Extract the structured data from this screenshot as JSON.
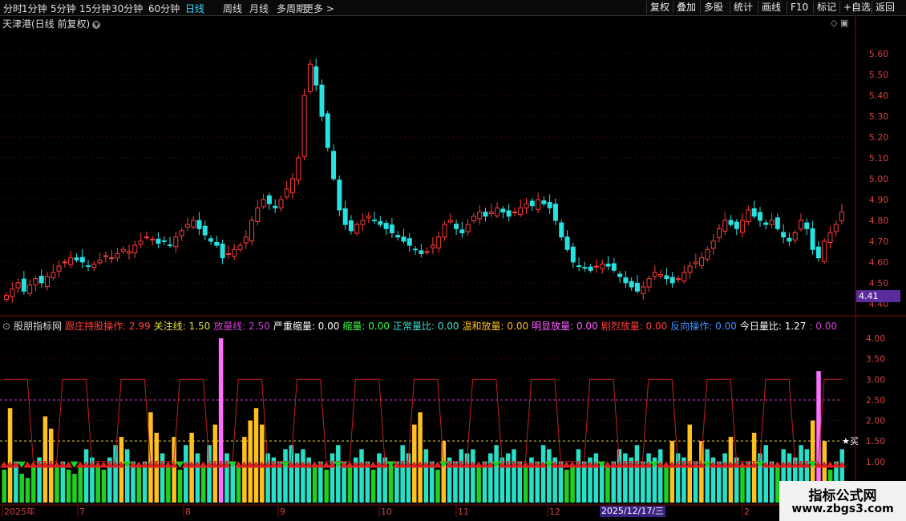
{
  "toolbar": {
    "periods": [
      "分时",
      "1分钟",
      "5分钟",
      "15分钟",
      "30分钟",
      "60分钟",
      "日线",
      "周线",
      "月线",
      "多周期",
      "更多 >"
    ],
    "active_period": "日线",
    "right_buttons": [
      "复权",
      "叠加",
      "多股",
      "统计",
      "画线",
      "F10",
      "标记",
      "+自选",
      "返回"
    ]
  },
  "main_chart": {
    "title": "天津港(日线 前复权)",
    "price_axis": [
      "5.60",
      "5.50",
      "5.40",
      "5.30",
      "5.20",
      "5.10",
      "5.00",
      "4.90",
      "4.80",
      "4.70",
      "4.60",
      "4.50",
      "4.40"
    ],
    "current_price": "4.41"
  },
  "indicator": {
    "name": "股朋指标网",
    "items": [
      {
        "text": "跟庄持股操作: 2.99",
        "color": "#ff4040"
      },
      {
        "text": "关注线: 1.50",
        "color": "#e8e040"
      },
      {
        "text": "放量线: 2.50",
        "color": "#d040d0"
      },
      {
        "text": "严重缩量: 0.00",
        "color": "#ffffff"
      },
      {
        "text": "缩量: 0.00",
        "color": "#40ff40"
      },
      {
        "text": "正常量比: 0.00",
        "color": "#40e0d0"
      },
      {
        "text": "温和放量: 0.00",
        "color": "#ffc020"
      },
      {
        "text": "明显放量: 0.00",
        "color": "#ff60ff"
      },
      {
        "text": "剧烈放量: 0.00",
        "color": "#ff4040"
      },
      {
        "text": "反向操作: 0.00",
        "color": "#4090ff"
      },
      {
        "text": "今日量比: 1.27",
        "color": "#ffffff"
      },
      {
        "text": ": 0.00",
        "color": "#d040d0"
      }
    ],
    "axis": [
      "4.00",
      "3.50",
      "3.00",
      "2.50",
      "2.00",
      "1.50",
      "1.00"
    ],
    "buy_label": "★买"
  },
  "date_axis": {
    "labels": [
      "2025年",
      "7",
      "8",
      "9",
      "10",
      "11",
      "12",
      "2"
    ],
    "selected_date": "2025/12/17/三"
  },
  "watermark": {
    "line1": "指标公式网",
    "line2": "www.zbgs3.com"
  },
  "colors": {
    "up": "#ff3b3b",
    "down": "#28e0e0",
    "bg": "#000000"
  },
  "chart_data": [
    {
      "type": "candlestick",
      "title": "天津港(日线 前复权)",
      "ylim": [
        4.38,
        5.72
      ],
      "close": [
        4.44,
        4.47,
        4.5,
        4.46,
        4.49,
        4.52,
        4.5,
        4.53,
        4.55,
        4.58,
        4.6,
        4.62,
        4.61,
        4.6,
        4.58,
        4.59,
        4.61,
        4.63,
        4.62,
        4.64,
        4.66,
        4.65,
        4.68,
        4.7,
        4.72,
        4.71,
        4.69,
        4.7,
        4.68,
        4.72,
        4.75,
        4.78,
        4.8,
        4.76,
        4.73,
        4.7,
        4.68,
        4.62,
        4.64,
        4.66,
        4.68,
        4.72,
        4.8,
        4.86,
        4.9,
        4.88,
        4.86,
        4.9,
        4.95,
        5.0,
        5.1,
        5.4,
        5.55,
        5.45,
        5.3,
        5.15,
        5.0,
        4.85,
        4.78,
        4.75,
        4.78,
        4.8,
        4.82,
        4.8,
        4.78,
        4.76,
        4.74,
        4.72,
        4.7,
        4.68,
        4.66,
        4.64,
        4.65,
        4.68,
        4.72,
        4.78,
        4.8,
        4.76,
        4.74,
        4.78,
        4.82,
        4.84,
        4.82,
        4.84,
        4.86,
        4.84,
        4.82,
        4.84,
        4.86,
        4.88,
        4.87,
        4.9,
        4.88,
        4.86,
        4.8,
        4.72,
        4.66,
        4.6,
        4.58,
        4.57,
        4.56,
        4.58,
        4.59,
        4.58,
        4.56,
        4.53,
        4.5,
        4.48,
        4.46,
        4.48,
        4.52,
        4.55,
        4.54,
        4.52,
        4.5,
        4.52,
        4.55,
        4.58,
        4.6,
        4.62,
        4.66,
        4.7,
        4.76,
        4.8,
        4.78,
        4.76,
        4.8,
        4.85,
        4.82,
        4.8,
        4.78,
        4.8,
        4.76,
        4.72,
        4.7,
        4.74,
        4.8,
        4.76,
        4.66,
        4.62,
        4.7,
        4.74,
        4.78,
        4.84
      ]
    },
    {
      "type": "bar",
      "title": "股朋指标网",
      "ylim": [
        0,
        4.1
      ],
      "series": [
        {
          "name": "关注线",
          "constant": 1.5
        },
        {
          "name": "放量线",
          "constant": 2.5
        }
      ],
      "volume_ratio": [
        0.8,
        2.3,
        1.0,
        0.7,
        0.6,
        0.9,
        1.1,
        2.1,
        1.8,
        0.9,
        1.0,
        0.8,
        0.7,
        0.9,
        1.3,
        1.1,
        0.9,
        0.8,
        1.1,
        1.4,
        1.6,
        1.3,
        1.0,
        0.9,
        1.0,
        2.2,
        1.7,
        1.2,
        0.9,
        1.6,
        0.8,
        1.4,
        1.7,
        1.2,
        0.9,
        1.4,
        1.9,
        4.0,
        1.2,
        1.0,
        0.9,
        1.6,
        2.0,
        2.3,
        1.9,
        1.2,
        1.1,
        1.0,
        1.3,
        1.4,
        1.2,
        1.3,
        1.1,
        0.9,
        1.0,
        0.8,
        1.2,
        1.4,
        1.0,
        0.9,
        1.1,
        1.3,
        1.0,
        0.8,
        1.2,
        1.1,
        0.9,
        1.0,
        1.4,
        1.2,
        1.9,
        2.2,
        1.3,
        1.0,
        0.8,
        1.5,
        1.1,
        1.0,
        1.3,
        1.2,
        1.3,
        0.9,
        1.0,
        1.2,
        1.4,
        1.1,
        1.2,
        1.3,
        1.0,
        0.9,
        1.1,
        1.0,
        1.4,
        1.3,
        1.1,
        1.0,
        0.8,
        0.9,
        1.3,
        1.0,
        1.1,
        1.2,
        1.0,
        0.9,
        1.0,
        1.3,
        1.2,
        1.1,
        1.4,
        1.0,
        1.2,
        1.1,
        1.3,
        0.9,
        1.5,
        1.2,
        1.1,
        1.9,
        1.0,
        1.5,
        1.3,
        1.1,
        1.0,
        1.2,
        1.6,
        1.1,
        0.9,
        1.0,
        1.7,
        1.2,
        1.4,
        1.0,
        0.9,
        1.3,
        1.2,
        1.1,
        1.4,
        1.3,
        2.0,
        3.2,
        1.5,
        0.8,
        1.0,
        1.3
      ]
    }
  ]
}
